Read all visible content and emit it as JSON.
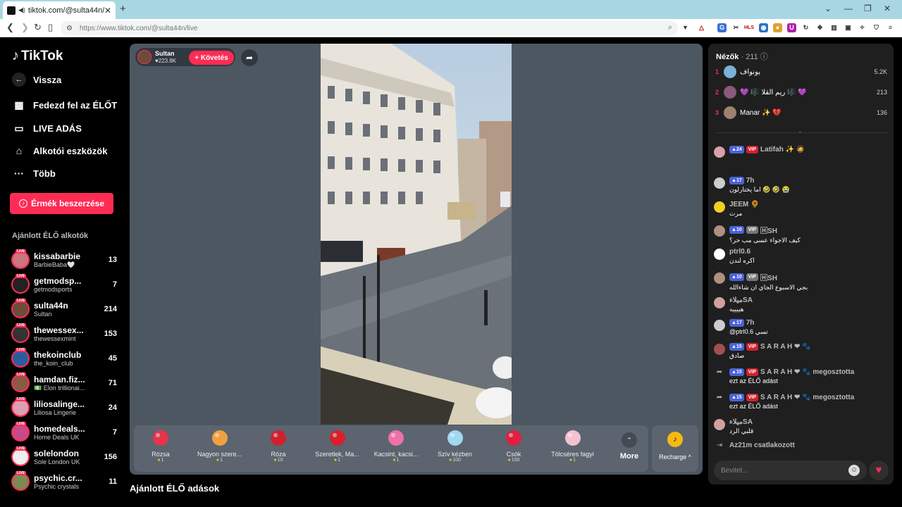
{
  "browser": {
    "tab_title": "tiktok.com/@sulta44n/live",
    "url": "https://www.tiktok.com/@sulta44n/live",
    "ext_label": "HLS"
  },
  "sidebar": {
    "logo": "TikTok",
    "back": "Vissza",
    "nav": [
      "Fedezd fel az ÉLŐT",
      "LIVE ADÁS",
      "Alkotói eszközök",
      "Több"
    ],
    "buy_coins": "Érmék beszerzése",
    "recommended_title": "Ajánlott ÉLŐ alkotók",
    "live_badge": "LIVE",
    "creators": [
      {
        "name": "kissabarbie",
        "sub": "BarbieBaba🤍",
        "count": "13",
        "color": "#c9767f"
      },
      {
        "name": "getmodsp...",
        "sub": "getmodsports",
        "count": "7",
        "color": "#222"
      },
      {
        "name": "sulta44n",
        "sub": "Sultan",
        "count": "214",
        "color": "#6b4d3a"
      },
      {
        "name": "thewessex...",
        "sub": "thewessexmint",
        "count": "153",
        "color": "#333"
      },
      {
        "name": "thekoinclub",
        "sub": "the_koin_club",
        "count": "45",
        "color": "#2b5d9e"
      },
      {
        "name": "hamdan.fiz...",
        "sub": "💵 Elon trillionai...",
        "count": "71",
        "color": "#8a5a44"
      },
      {
        "name": "liliosalinge...",
        "sub": "Liliosa Lingerie",
        "count": "24",
        "color": "#d9a0b4"
      },
      {
        "name": "homedeals...",
        "sub": "Home Deals UK",
        "count": "7",
        "color": "#c84a8a"
      },
      {
        "name": "solelondon",
        "sub": "Sole London UK",
        "count": "156",
        "color": "#eee"
      },
      {
        "name": "psychic.cr...",
        "sub": "Psychic crystals",
        "count": "11",
        "color": "#7a8a52"
      }
    ]
  },
  "stream": {
    "host_name": "Sultan",
    "host_likes": "♥223.8K",
    "follow": "+ Követés",
    "gifts": [
      {
        "name": "Rózsa",
        "price": "1",
        "icon": "rose-icon",
        "color": "#e8344a"
      },
      {
        "name": "Nagyon szere...",
        "price": "1",
        "icon": "love-face-icon",
        "color": "#f0a040"
      },
      {
        "name": "Róza",
        "price": "10",
        "icon": "rose-bouquet-icon",
        "color": "#d02030"
      },
      {
        "name": "Szeretlek, Ma...",
        "price": "1",
        "icon": "heart-icon",
        "color": "#d8202c"
      },
      {
        "name": "Kacsint, kacsi...",
        "price": "1",
        "icon": "wink-heart-icon",
        "color": "#f070a8"
      },
      {
        "name": "Szív kézben",
        "price": "100",
        "icon": "hand-heart-icon",
        "color": "#a0d8f0"
      },
      {
        "name": "Csók",
        "price": "150",
        "icon": "kiss-icon",
        "color": "#e02040"
      },
      {
        "name": "Tölcséres fagyi",
        "price": "1",
        "icon": "ice-cream-icon",
        "color": "#f5c0d0"
      }
    ],
    "more": "More",
    "recharge": "Recharge ^"
  },
  "recommended_live": "Ajánlott ÉLŐ adások",
  "panel": {
    "viewers_label": "Nézők",
    "viewers_count": "· 211",
    "top_viewers": [
      {
        "rank": "1",
        "name": "يونواف",
        "score": "5.2K",
        "color": "#7ab0d8"
      },
      {
        "rank": "2",
        "name": "💜 🎼 ريم القلا 🎼 💜",
        "score": "213",
        "color": "#8a5a7a"
      },
      {
        "rank": "3",
        "name": "Manar ✨ 💔",
        "score": "136",
        "color": "#a08070"
      }
    ],
    "messages": [
      {
        "level": "24",
        "vip": "VIP",
        "user": "Latifah ✨ 🧔",
        "text": "",
        "color": "#d8a0a8"
      },
      {
        "level": "17",
        "vip": "",
        "user": "7h",
        "text": "اما يختارلون 🤣 🤣 😭",
        "color": "#ccc"
      },
      {
        "level": "",
        "vip": "",
        "user": "JEEM 🌻",
        "text": "مرت",
        "color": "#f0d020"
      },
      {
        "level": "10",
        "vip": "VIP",
        "user": "🄷SH",
        "text": "كيف الاجواء عسى مب حر؟",
        "color": "#b09080"
      },
      {
        "level": "",
        "vip": "",
        "user": "ptrl0.6",
        "text": "اكره لندن",
        "color": "#fff"
      },
      {
        "level": "10",
        "vip": "VIP",
        "user": "🄷SH",
        "text": "بجي الاسبوع الجاي ان شاءالله",
        "color": "#b09080"
      },
      {
        "level": "",
        "vip": "",
        "user": "ميلاءSA",
        "text": "هييييه",
        "color": "#d0a0a0"
      },
      {
        "level": "17",
        "vip": "",
        "user": "7h",
        "text": "@ptrl0.6 تسي",
        "color": "#ccc"
      },
      {
        "level": "15",
        "vip": "VIP",
        "user": "S A R A H ❤ 🐾",
        "text": "صادق",
        "color": "#a05050"
      },
      {
        "level": "15",
        "vip": "VIP",
        "user": "S A R A H ❤ 🐾  megosztotta",
        "text": "ezt az ÉLŐ adást",
        "color": ""
      },
      {
        "level": "15",
        "vip": "VIP",
        "user": "S A R A H ❤ 🐾  megosztotta",
        "text": "ezt az ÉLŐ adást",
        "color": ""
      },
      {
        "level": "",
        "vip": "",
        "user": "ميلاءSA",
        "text": "قلبي الرد",
        "color": "#d0a0a0"
      },
      {
        "level": "",
        "vip": "",
        "user": "Az21m  csatlakozott",
        "text": "",
        "color": ""
      }
    ],
    "input_placeholder": "Bevitel..."
  },
  "colors": {
    "accent": "#fe2c55",
    "stage": "#4d5762",
    "panel": "#1f1f1f"
  }
}
